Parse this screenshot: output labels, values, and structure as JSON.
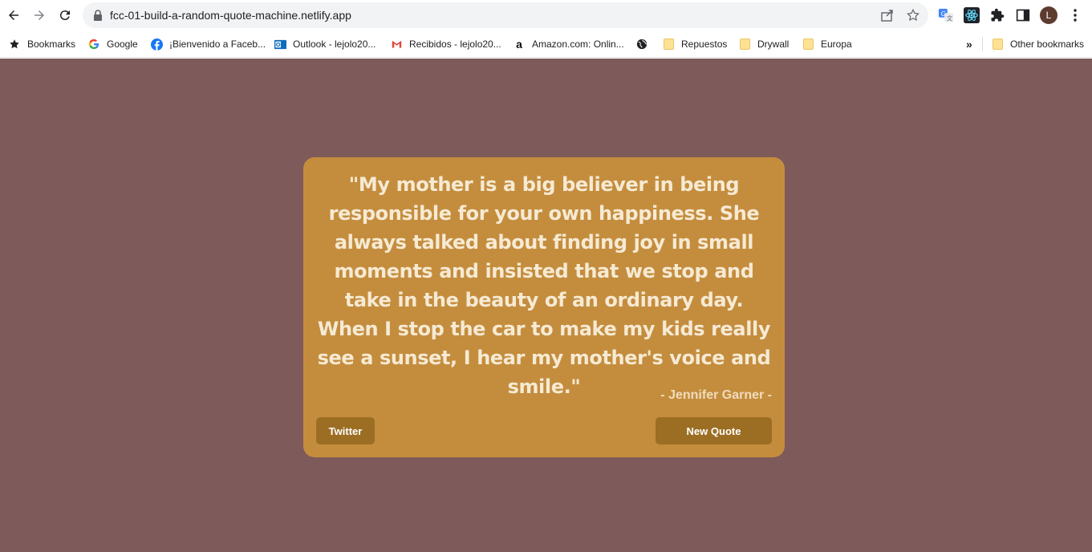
{
  "browser": {
    "url": "fcc-01-build-a-random-quote-machine.netlify.app",
    "avatar_letter": "L"
  },
  "bookmarks": {
    "items": [
      {
        "label": "Bookmarks",
        "icon": "star-icon"
      },
      {
        "label": "Google",
        "icon": "google-icon"
      },
      {
        "label": "¡Bienvenido a Faceb...",
        "icon": "facebook-icon"
      },
      {
        "label": "Outlook - lejolo20...",
        "icon": "outlook-icon"
      },
      {
        "label": "Recibidos - lejolo20...",
        "icon": "gmail-icon"
      },
      {
        "label": "Amazon.com: Onlin...",
        "icon": "amazon-icon"
      },
      {
        "label": "",
        "icon": "globe-icon"
      },
      {
        "label": "Repuestos",
        "icon": "folder-icon"
      },
      {
        "label": "Drywall",
        "icon": "folder-icon"
      },
      {
        "label": "Europa",
        "icon": "folder-icon"
      }
    ],
    "overflow": "»",
    "other": "Other bookmarks"
  },
  "quote": {
    "text": "\"My mother is a big believer in being responsible for your own happiness. She always talked about finding joy in small moments and insisted that we stop and take in the beauty of an ordinary day. When I stop the car to make my kids really see a sunset, I hear my mother's voice and smile.\"",
    "author": "- Jennifer Garner -"
  },
  "actions": {
    "twitter_label": "Twitter",
    "new_quote_label": "New Quote"
  },
  "colors": {
    "page_bg": "#7e5a5a",
    "card_bg": "#c48d3e",
    "button_bg": "#9c6e24"
  }
}
